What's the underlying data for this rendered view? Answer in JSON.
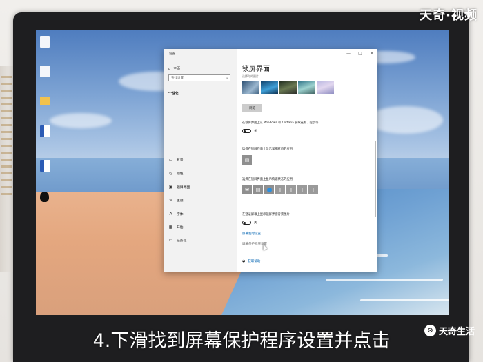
{
  "watermark": {
    "top_right": "天奇·视频",
    "bottom_right": "天奇生活",
    "bottom_logo_icon": "tianqi-logo-icon"
  },
  "caption": "4.下滑找到屏幕保护程序设置并点击",
  "desktop": {
    "icons": [
      {
        "name": "unknown-app",
        "label": "",
        "kind": "doc"
      },
      {
        "name": "document",
        "label": "",
        "kind": "doc"
      },
      {
        "name": "folder",
        "label": "",
        "kind": "folder"
      },
      {
        "name": "word-doc-1",
        "label": "",
        "kind": "word"
      },
      {
        "name": "word-doc-2",
        "label": "",
        "kind": "word"
      },
      {
        "name": "qq",
        "label": "",
        "kind": "qq"
      }
    ]
  },
  "settings_window": {
    "title": "设置",
    "controls": {
      "minimize": "—",
      "maximize": "□",
      "close": "✕"
    },
    "nav": {
      "home_label": "主页",
      "search_placeholder": "查找设置",
      "section": "个性化",
      "items": [
        {
          "label": "背景",
          "icon": "image-icon"
        },
        {
          "label": "颜色",
          "icon": "palette-icon"
        },
        {
          "label": "锁屏界面",
          "icon": "lock-screen-icon",
          "active": true
        },
        {
          "label": "主题",
          "icon": "brush-icon"
        },
        {
          "label": "字体",
          "icon": "font-icon"
        },
        {
          "label": "开始",
          "icon": "start-icon"
        },
        {
          "label": "任务栏",
          "icon": "taskbar-icon"
        }
      ]
    },
    "content": {
      "title": "锁屏界面",
      "subtitle": "选择你的图片",
      "browse_label": "浏览",
      "cortana_text": "在锁屏界面上从 Windows 和 Cortana 获取花絮、提示等",
      "cortana_toggle": "关",
      "detail_app_text": "选择在锁屏界面上显示详细状态的应用",
      "quick_app_text": "选择在锁屏界面上显示快速状态的应用",
      "signin_bg_text": "在登录屏幕上显示锁屏界面背景图片",
      "signin_toggle": "关",
      "timeout_link": "屏幕超时设置",
      "screensaver_link": "屏幕保护程序设置",
      "help_link": "获取帮助"
    }
  }
}
